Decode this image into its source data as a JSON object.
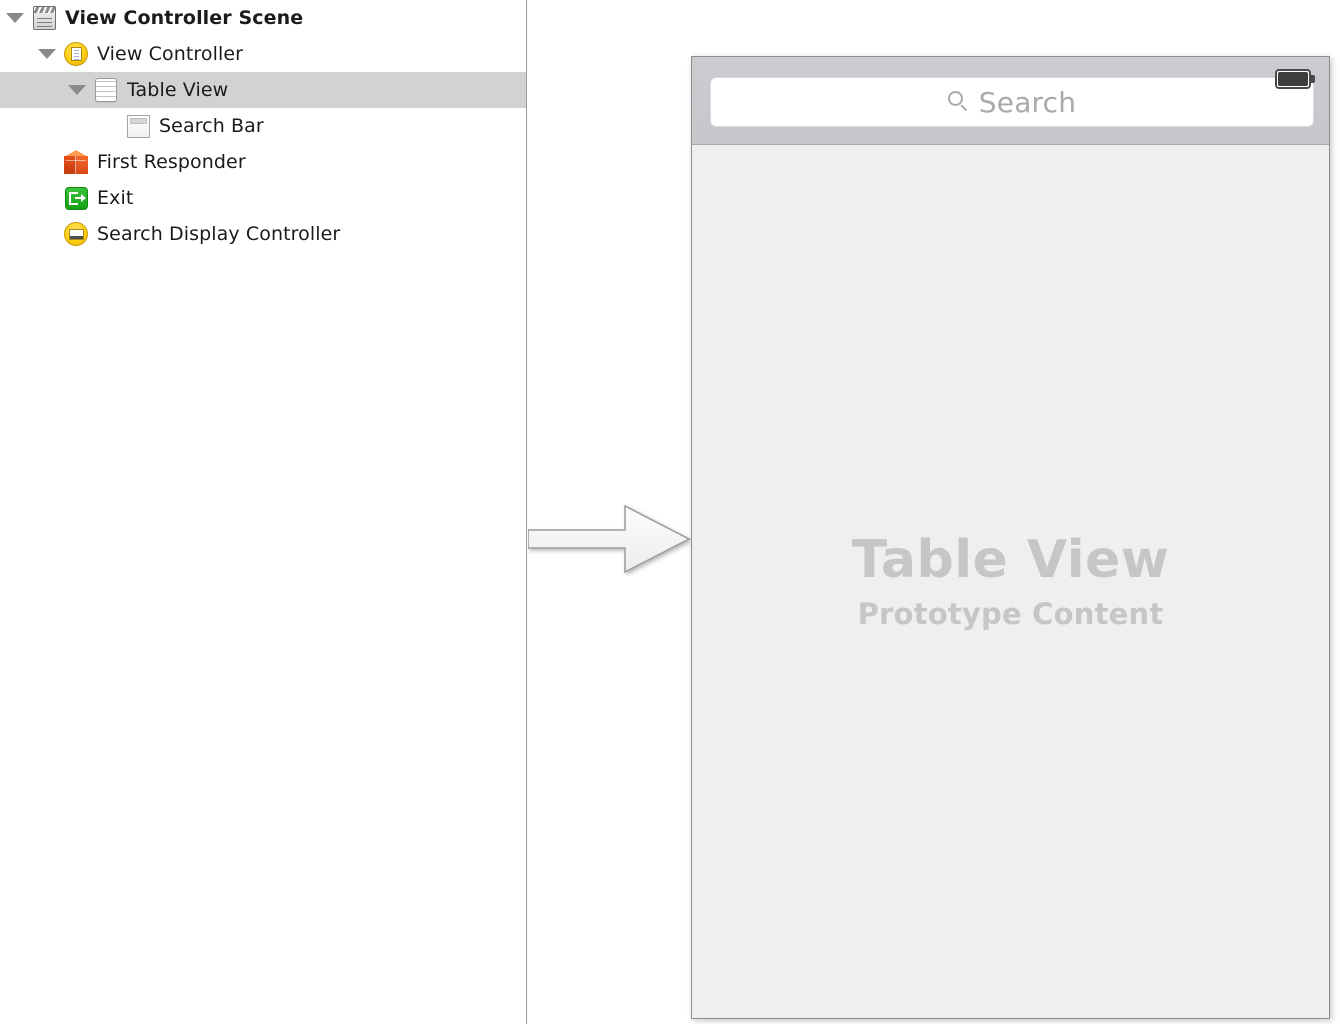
{
  "outline": {
    "rows": [
      {
        "label": "View Controller Scene",
        "icon": "scene-clapperboard-icon",
        "indent": 0,
        "disclosure": "expanded",
        "bold": true,
        "selected": false
      },
      {
        "label": "View Controller",
        "icon": "view-controller-icon",
        "indent": 1,
        "disclosure": "expanded",
        "bold": false,
        "selected": false
      },
      {
        "label": "Table View",
        "icon": "table-view-icon",
        "indent": 2,
        "disclosure": "expanded",
        "bold": false,
        "selected": true
      },
      {
        "label": "Search Bar",
        "icon": "search-bar-icon",
        "indent": 3,
        "disclosure": "none",
        "bold": false,
        "selected": false
      },
      {
        "label": "First Responder",
        "icon": "first-responder-cube-icon",
        "indent": 1,
        "disclosure": "none",
        "bold": false,
        "selected": false
      },
      {
        "label": "Exit",
        "icon": "exit-icon",
        "indent": 1,
        "disclosure": "none",
        "bold": false,
        "selected": false
      },
      {
        "label": "Search Display Controller",
        "icon": "search-display-controller-icon",
        "indent": 1,
        "disclosure": "none",
        "bold": false,
        "selected": false
      }
    ]
  },
  "canvas": {
    "entry_arrow": "storyboard-entry-point-arrow",
    "scene": {
      "search_bar": {
        "placeholder": "Search",
        "magnifier_icon": "search-icon",
        "battery_icon": "battery-icon"
      },
      "table_view": {
        "title": "Table View",
        "subtitle": "Prototype Content"
      }
    }
  },
  "colors": {
    "selection": "#d2d2d2",
    "canvas_background": "#ffffff",
    "scene_content": "#efefef",
    "search_bar_chrome": "#c8c8cd",
    "placeholder_text": "#c6c6c6",
    "divider": "#9a9a9a"
  }
}
